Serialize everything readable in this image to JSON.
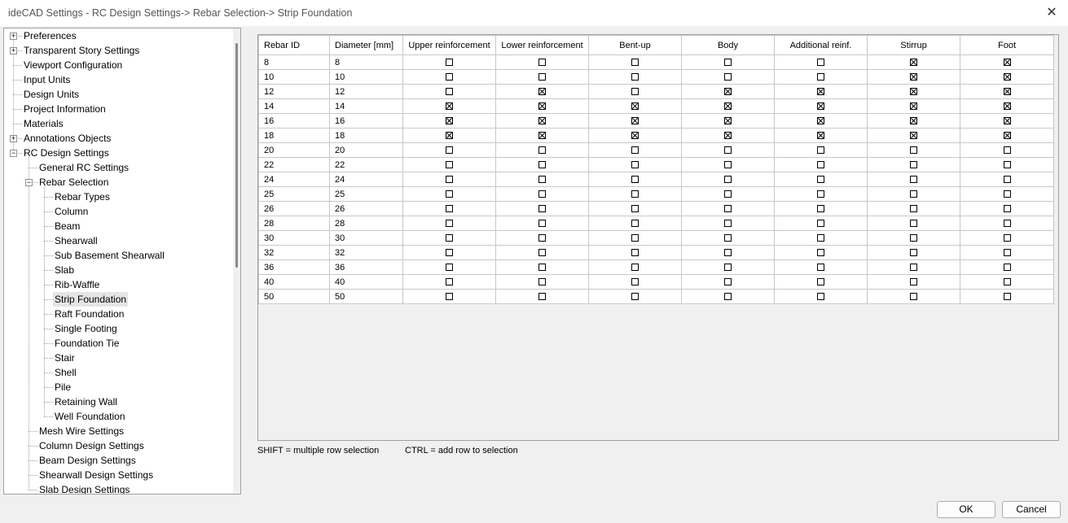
{
  "window": {
    "title": "ideCAD Settings - RC Design Settings-> Rebar Selection-> Strip Foundation",
    "close_glyph": "✕"
  },
  "tree": {
    "nodes": [
      {
        "label": "Preferences",
        "depth": 0,
        "expander": "+"
      },
      {
        "label": "Transparent Story Settings",
        "depth": 0,
        "expander": "+"
      },
      {
        "label": "Viewport Configuration",
        "depth": 0
      },
      {
        "label": "Input Units",
        "depth": 0
      },
      {
        "label": "Design Units",
        "depth": 0
      },
      {
        "label": "Project Information",
        "depth": 0
      },
      {
        "label": "Materials",
        "depth": 0
      },
      {
        "label": "Annotations Objects",
        "depth": 0,
        "expander": "+"
      },
      {
        "label": "RC Design Settings",
        "depth": 0,
        "expander": "−"
      },
      {
        "label": "General RC Settings",
        "depth": 1
      },
      {
        "label": "Rebar Selection",
        "depth": 1,
        "expander": "−"
      },
      {
        "label": "Rebar Types",
        "depth": 2
      },
      {
        "label": "Column",
        "depth": 2
      },
      {
        "label": "Beam",
        "depth": 2
      },
      {
        "label": "Shearwall",
        "depth": 2
      },
      {
        "label": "Sub Basement Shearwall",
        "depth": 2
      },
      {
        "label": "Slab",
        "depth": 2
      },
      {
        "label": "Rib-Waffle",
        "depth": 2
      },
      {
        "label": "Strip Foundation",
        "depth": 2,
        "selected": true
      },
      {
        "label": "Raft Foundation",
        "depth": 2
      },
      {
        "label": "Single Footing",
        "depth": 2
      },
      {
        "label": "Foundation Tie",
        "depth": 2
      },
      {
        "label": "Stair",
        "depth": 2
      },
      {
        "label": "Shell",
        "depth": 2
      },
      {
        "label": "Pile",
        "depth": 2
      },
      {
        "label": "Retaining Wall",
        "depth": 2
      },
      {
        "label": "Well Foundation",
        "depth": 2
      },
      {
        "label": "Mesh Wire Settings",
        "depth": 1
      },
      {
        "label": "Column Design Settings",
        "depth": 1
      },
      {
        "label": "Beam Design Settings",
        "depth": 1
      },
      {
        "label": "Shearwall Design Settings",
        "depth": 1
      },
      {
        "label": "Slab Design Settings",
        "depth": 1
      }
    ]
  },
  "grid": {
    "columns": [
      "Rebar ID",
      "Diameter [mm]",
      "Upper reinforcement",
      "Lower reinforcement",
      "Bent-up",
      "Body",
      "Additional reinf.",
      "Stirrup",
      "Foot"
    ],
    "rows": [
      {
        "id": "8",
        "diameter": "8",
        "checks": [
          0,
          0,
          0,
          0,
          0,
          1,
          1
        ]
      },
      {
        "id": "10",
        "diameter": "10",
        "checks": [
          0,
          0,
          0,
          0,
          0,
          1,
          1
        ]
      },
      {
        "id": "12",
        "diameter": "12",
        "checks": [
          0,
          1,
          0,
          1,
          1,
          1,
          1
        ]
      },
      {
        "id": "14",
        "diameter": "14",
        "checks": [
          1,
          1,
          1,
          1,
          1,
          1,
          1
        ]
      },
      {
        "id": "16",
        "diameter": "16",
        "checks": [
          1,
          1,
          1,
          1,
          1,
          1,
          1
        ]
      },
      {
        "id": "18",
        "diameter": "18",
        "checks": [
          1,
          1,
          1,
          1,
          1,
          1,
          1
        ]
      },
      {
        "id": "20",
        "diameter": "20",
        "checks": [
          0,
          0,
          0,
          0,
          0,
          0,
          0
        ]
      },
      {
        "id": "22",
        "diameter": "22",
        "checks": [
          0,
          0,
          0,
          0,
          0,
          0,
          0
        ]
      },
      {
        "id": "24",
        "diameter": "24",
        "checks": [
          0,
          0,
          0,
          0,
          0,
          0,
          0
        ]
      },
      {
        "id": "25",
        "diameter": "25",
        "checks": [
          0,
          0,
          0,
          0,
          0,
          0,
          0
        ]
      },
      {
        "id": "26",
        "diameter": "26",
        "checks": [
          0,
          0,
          0,
          0,
          0,
          0,
          0
        ]
      },
      {
        "id": "28",
        "diameter": "28",
        "checks": [
          0,
          0,
          0,
          0,
          0,
          0,
          0
        ]
      },
      {
        "id": "30",
        "diameter": "30",
        "checks": [
          0,
          0,
          0,
          0,
          0,
          0,
          0
        ]
      },
      {
        "id": "32",
        "diameter": "32",
        "checks": [
          0,
          0,
          0,
          0,
          0,
          0,
          0
        ]
      },
      {
        "id": "36",
        "diameter": "36",
        "checks": [
          0,
          0,
          0,
          0,
          0,
          0,
          0
        ]
      },
      {
        "id": "40",
        "diameter": "40",
        "checks": [
          0,
          0,
          0,
          0,
          0,
          0,
          0
        ]
      },
      {
        "id": "50",
        "diameter": "50",
        "checks": [
          0,
          0,
          0,
          0,
          0,
          0,
          0
        ]
      }
    ]
  },
  "hints": {
    "shift": "SHIFT = multiple row selection",
    "ctrl": "CTRL = add row to selection"
  },
  "buttons": {
    "ok": "OK",
    "cancel": "Cancel"
  }
}
